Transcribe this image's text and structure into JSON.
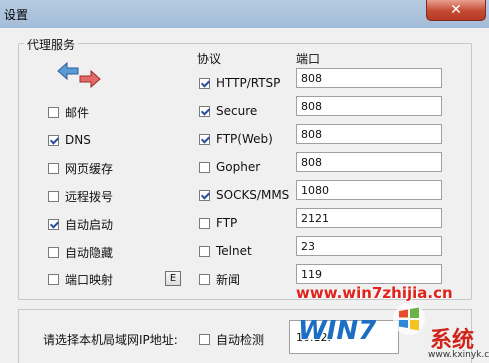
{
  "window": {
    "title": "设置",
    "close_glyph": "✕"
  },
  "proxy_group": {
    "title": "代理服务"
  },
  "headers": {
    "protocol": "协议",
    "port": "端口"
  },
  "left_options": [
    {
      "label": "邮件",
      "checked": false
    },
    {
      "label": "DNS",
      "checked": true
    },
    {
      "label": "网页缓存",
      "checked": false
    },
    {
      "label": "远程拨号",
      "checked": false
    },
    {
      "label": "自动启动",
      "checked": true
    },
    {
      "label": "自动隐藏",
      "checked": false
    },
    {
      "label": "端口映射",
      "checked": false
    }
  ],
  "port_mapping_button": "E",
  "protocols": [
    {
      "label": "HTTP/RTSP",
      "checked": true,
      "port": "808"
    },
    {
      "label": "Secure",
      "checked": true,
      "port": "808"
    },
    {
      "label": "FTP(Web)",
      "checked": true,
      "port": "808"
    },
    {
      "label": "Gopher",
      "checked": false,
      "port": "808"
    },
    {
      "label": "SOCKS/MMS",
      "checked": true,
      "port": "1080"
    },
    {
      "label": "FTP",
      "checked": false,
      "port": "2121"
    },
    {
      "label": "Telnet",
      "checked": false,
      "port": "23"
    },
    {
      "label": "新闻",
      "checked": false,
      "port": "119"
    }
  ],
  "lan": {
    "label": "请选择本机局域网IP地址:",
    "auto_detect_label": "自动检测",
    "auto_detect_checked": false,
    "ip_value": "10.12."
  },
  "watermark": {
    "url": "www.win7zhijia.cn",
    "logo": "WIN7",
    "brand2": "系统",
    "brand2_url": "www.kxinyk.com"
  },
  "colors": {
    "titlebar": "#a8c0dc",
    "close_button": "#c44a33",
    "watermark_red": "#e0231c",
    "watermark_blue": "#1c6dc4"
  }
}
